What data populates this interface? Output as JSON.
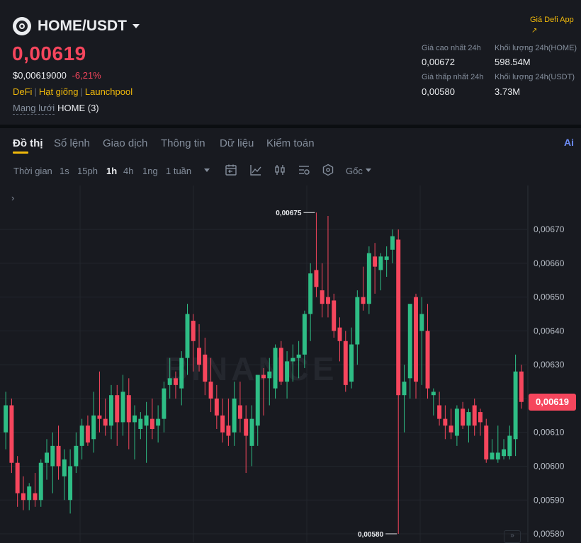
{
  "header": {
    "pair": "HOME/USDT",
    "price": "0,00619",
    "usd_price": "$0,00619000",
    "change": "-6,21%",
    "tags": [
      "DeFi",
      "Hạt giống",
      "Launchpool"
    ],
    "network_label": "Mạng lưới",
    "network_value": "HOME (3)",
    "defi_link": "Giá Defi App",
    "defi_arrow": "↗",
    "stats": {
      "high_label": "Giá cao nhất 24h",
      "high_value": "0,00672",
      "low_label": "Giá thấp nhất 24h",
      "low_value": "0,00580",
      "vol_home_label": "Khối lượng 24h(HOME)",
      "vol_home_value": "598.54M",
      "vol_usdt_label": "Khối lượng 24h(USDT)",
      "vol_usdt_value": "3.73M"
    }
  },
  "tabs": [
    "Đồ thị",
    "Sổ lệnh",
    "Giao dịch",
    "Thông tin",
    "Dữ liệu",
    "Kiểm toán"
  ],
  "ai_label": "Ai",
  "toolbar": {
    "time_label": "Thời gian",
    "intervals": [
      "1s",
      "15ph",
      "1h",
      "4h",
      "1ng",
      "1 tuần"
    ],
    "active_interval": "1h",
    "price_mode": "Gốc"
  },
  "chart": {
    "panel_toggle": "›",
    "watermark": "BINANCE",
    "scroll_label": "»",
    "current_price_label": "0,00619",
    "high_marker": "0,00675",
    "low_marker": "0,00580"
  },
  "colors": {
    "up": "#2ebd85",
    "down": "#f6465d",
    "accent": "#f0b90b",
    "bg": "#181a20"
  },
  "chart_data": {
    "type": "candlestick",
    "y_ticks": [
      "0,00670",
      "0,00660",
      "0,00650",
      "0,00640",
      "0,00630",
      "0,00620",
      "0,00610",
      "0,00600",
      "0,00590",
      "0,00580"
    ],
    "tick_values": [
      0.0067,
      0.0066,
      0.0065,
      0.0064,
      0.0063,
      0.0062,
      0.0061,
      0.006,
      0.0059,
      0.0058
    ],
    "ylim": [
      0.005775,
      0.00683
    ],
    "current_price": 0.00619,
    "high_point": {
      "label": "0,00675",
      "value": 0.00675
    },
    "low_point": {
      "label": "0,00580",
      "value": 0.0058
    },
    "candles": [
      {
        "o": 0.0061,
        "h": 0.00622,
        "l": 0.00605,
        "c": 0.00618
      },
      {
        "o": 0.00618,
        "h": 0.0062,
        "l": 0.00598,
        "c": 0.00601
      },
      {
        "o": 0.00601,
        "h": 0.00603,
        "l": 0.00588,
        "c": 0.00592
      },
      {
        "o": 0.00592,
        "h": 0.00597,
        "l": 0.00587,
        "c": 0.0059
      },
      {
        "o": 0.0059,
        "h": 0.00595,
        "l": 0.00587,
        "c": 0.00594
      },
      {
        "o": 0.00592,
        "h": 0.00598,
        "l": 0.00588,
        "c": 0.0059
      },
      {
        "o": 0.0059,
        "h": 0.00602,
        "l": 0.00588,
        "c": 0.00601
      },
      {
        "o": 0.00601,
        "h": 0.00608,
        "l": 0.00596,
        "c": 0.00604
      },
      {
        "o": 0.006,
        "h": 0.0061,
        "l": 0.00592,
        "c": 0.00606
      },
      {
        "o": 0.00606,
        "h": 0.00612,
        "l": 0.00596,
        "c": 0.006
      },
      {
        "o": 0.00597,
        "h": 0.00605,
        "l": 0.0059,
        "c": 0.00602
      },
      {
        "o": 0.0059,
        "h": 0.00605,
        "l": 0.00586,
        "c": 0.006
      },
      {
        "o": 0.006,
        "h": 0.0061,
        "l": 0.00598,
        "c": 0.00606
      },
      {
        "o": 0.00606,
        "h": 0.00614,
        "l": 0.00602,
        "c": 0.00612
      },
      {
        "o": 0.00612,
        "h": 0.00615,
        "l": 0.00606,
        "c": 0.00607
      },
      {
        "o": 0.00608,
        "h": 0.00622,
        "l": 0.00604,
        "c": 0.00615
      },
      {
        "o": 0.00615,
        "h": 0.00628,
        "l": 0.0061,
        "c": 0.00614
      },
      {
        "o": 0.00614,
        "h": 0.0062,
        "l": 0.00609,
        "c": 0.00612
      },
      {
        "o": 0.00612,
        "h": 0.00624,
        "l": 0.00608,
        "c": 0.00621
      },
      {
        "o": 0.00621,
        "h": 0.00624,
        "l": 0.00606,
        "c": 0.00613
      },
      {
        "o": 0.00613,
        "h": 0.00627,
        "l": 0.00609,
        "c": 0.00622
      },
      {
        "o": 0.00621,
        "h": 0.00626,
        "l": 0.00605,
        "c": 0.00613
      },
      {
        "o": 0.00613,
        "h": 0.00618,
        "l": 0.00602,
        "c": 0.00615
      },
      {
        "o": 0.00611,
        "h": 0.00616,
        "l": 0.00608,
        "c": 0.00614
      },
      {
        "o": 0.00612,
        "h": 0.00619,
        "l": 0.00601,
        "c": 0.00615
      },
      {
        "o": 0.00614,
        "h": 0.0062,
        "l": 0.00608,
        "c": 0.00611
      },
      {
        "o": 0.00612,
        "h": 0.00618,
        "l": 0.00607,
        "c": 0.00614
      },
      {
        "o": 0.00614,
        "h": 0.00625,
        "l": 0.0061,
        "c": 0.00623
      },
      {
        "o": 0.00624,
        "h": 0.00632,
        "l": 0.0062,
        "c": 0.00626
      },
      {
        "o": 0.00626,
        "h": 0.00628,
        "l": 0.0062,
        "c": 0.00624
      },
      {
        "o": 0.00623,
        "h": 0.00634,
        "l": 0.00618,
        "c": 0.00632
      },
      {
        "o": 0.00632,
        "h": 0.00648,
        "l": 0.00627,
        "c": 0.00645
      },
      {
        "o": 0.00643,
        "h": 0.00645,
        "l": 0.00628,
        "c": 0.00637
      },
      {
        "o": 0.00635,
        "h": 0.00642,
        "l": 0.00628,
        "c": 0.0063
      },
      {
        "o": 0.00633,
        "h": 0.00638,
        "l": 0.00621,
        "c": 0.00625
      },
      {
        "o": 0.00625,
        "h": 0.00632,
        "l": 0.00616,
        "c": 0.0062
      },
      {
        "o": 0.0062,
        "h": 0.00624,
        "l": 0.00611,
        "c": 0.00615
      },
      {
        "o": 0.00615,
        "h": 0.0062,
        "l": 0.00607,
        "c": 0.0061
      },
      {
        "o": 0.00612,
        "h": 0.0062,
        "l": 0.00606,
        "c": 0.00609
      },
      {
        "o": 0.0061,
        "h": 0.00625,
        "l": 0.00606,
        "c": 0.0062
      },
      {
        "o": 0.00618,
        "h": 0.00625,
        "l": 0.0061,
        "c": 0.00614
      },
      {
        "o": 0.00614,
        "h": 0.00618,
        "l": 0.00598,
        "c": 0.00609
      },
      {
        "o": 0.00606,
        "h": 0.00618,
        "l": 0.006,
        "c": 0.00614
      },
      {
        "o": 0.00612,
        "h": 0.00627,
        "l": 0.00606,
        "c": 0.00627
      },
      {
        "o": 0.00627,
        "h": 0.00629,
        "l": 0.00615,
        "c": 0.00626
      },
      {
        "o": 0.00626,
        "h": 0.00632,
        "l": 0.00618,
        "c": 0.00628
      },
      {
        "o": 0.00623,
        "h": 0.00636,
        "l": 0.0062,
        "c": 0.00635
      },
      {
        "o": 0.00635,
        "h": 0.00637,
        "l": 0.00624,
        "c": 0.00625
      },
      {
        "o": 0.00625,
        "h": 0.00634,
        "l": 0.0062,
        "c": 0.00631
      },
      {
        "o": 0.00631,
        "h": 0.00636,
        "l": 0.00625,
        "c": 0.00632
      },
      {
        "o": 0.00632,
        "h": 0.00637,
        "l": 0.00626,
        "c": 0.00633
      },
      {
        "o": 0.00633,
        "h": 0.00646,
        "l": 0.00629,
        "c": 0.00645
      },
      {
        "o": 0.00645,
        "h": 0.0066,
        "l": 0.00637,
        "c": 0.00657
      },
      {
        "o": 0.00658,
        "h": 0.00675,
        "l": 0.0065,
        "c": 0.00653
      },
      {
        "o": 0.00652,
        "h": 0.0066,
        "l": 0.00644,
        "c": 0.00648
      },
      {
        "o": 0.0065,
        "h": 0.00674,
        "l": 0.00644,
        "c": 0.00648
      },
      {
        "o": 0.00649,
        "h": 0.00651,
        "l": 0.00638,
        "c": 0.0064
      },
      {
        "o": 0.00641,
        "h": 0.00644,
        "l": 0.00631,
        "c": 0.00637
      },
      {
        "o": 0.00637,
        "h": 0.0064,
        "l": 0.00622,
        "c": 0.00624
      },
      {
        "o": 0.00625,
        "h": 0.00641,
        "l": 0.00623,
        "c": 0.00636
      },
      {
        "o": 0.00636,
        "h": 0.00652,
        "l": 0.0063,
        "c": 0.0065
      },
      {
        "o": 0.0065,
        "h": 0.00659,
        "l": 0.00646,
        "c": 0.00648
      },
      {
        "o": 0.00648,
        "h": 0.00665,
        "l": 0.00645,
        "c": 0.00663
      },
      {
        "o": 0.00662,
        "h": 0.00666,
        "l": 0.00651,
        "c": 0.00659
      },
      {
        "o": 0.00658,
        "h": 0.00663,
        "l": 0.00652,
        "c": 0.00662
      },
      {
        "o": 0.00661,
        "h": 0.00665,
        "l": 0.00656,
        "c": 0.00662
      },
      {
        "o": 0.00664,
        "h": 0.0067,
        "l": 0.0066,
        "c": 0.00668
      },
      {
        "o": 0.00667,
        "h": 0.0067,
        "l": 0.0058,
        "c": 0.00621
      },
      {
        "o": 0.00621,
        "h": 0.0063,
        "l": 0.0061,
        "c": 0.00625
      },
      {
        "o": 0.00626,
        "h": 0.0064,
        "l": 0.0062,
        "c": 0.00648
      },
      {
        "o": 0.0065,
        "h": 0.00651,
        "l": 0.0062,
        "c": 0.00625
      },
      {
        "o": 0.0064,
        "h": 0.0065,
        "l": 0.00624,
        "c": 0.00645
      },
      {
        "o": 0.0064,
        "h": 0.00648,
        "l": 0.0062,
        "c": 0.00623
      },
      {
        "o": 0.00621,
        "h": 0.00623,
        "l": 0.00615,
        "c": 0.00622
      },
      {
        "o": 0.00618,
        "h": 0.00622,
        "l": 0.00612,
        "c": 0.00614
      },
      {
        "o": 0.00614,
        "h": 0.00618,
        "l": 0.00608,
        "c": 0.00612
      },
      {
        "o": 0.00612,
        "h": 0.00617,
        "l": 0.00608,
        "c": 0.0061
      },
      {
        "o": 0.00609,
        "h": 0.00618,
        "l": 0.00606,
        "c": 0.00617
      },
      {
        "o": 0.00617,
        "h": 0.00619,
        "l": 0.00611,
        "c": 0.00612
      },
      {
        "o": 0.00612,
        "h": 0.00617,
        "l": 0.00607,
        "c": 0.00616
      },
      {
        "o": 0.00618,
        "h": 0.0062,
        "l": 0.00609,
        "c": 0.00612
      },
      {
        "o": 0.00616,
        "h": 0.00617,
        "l": 0.00609,
        "c": 0.00613
      },
      {
        "o": 0.00612,
        "h": 0.00614,
        "l": 0.00601,
        "c": 0.00602
      },
      {
        "o": 0.00602,
        "h": 0.00608,
        "l": 0.00602,
        "c": 0.00604
      },
      {
        "o": 0.00602,
        "h": 0.00612,
        "l": 0.00601,
        "c": 0.00604
      },
      {
        "o": 0.00603,
        "h": 0.00608,
        "l": 0.00602,
        "c": 0.00605
      },
      {
        "o": 0.00603,
        "h": 0.00612,
        "l": 0.00602,
        "c": 0.00609
      },
      {
        "o": 0.00608,
        "h": 0.00633,
        "l": 0.00603,
        "c": 0.00628
      },
      {
        "o": 0.00628,
        "h": 0.0063,
        "l": 0.00617,
        "c": 0.00619
      }
    ]
  }
}
